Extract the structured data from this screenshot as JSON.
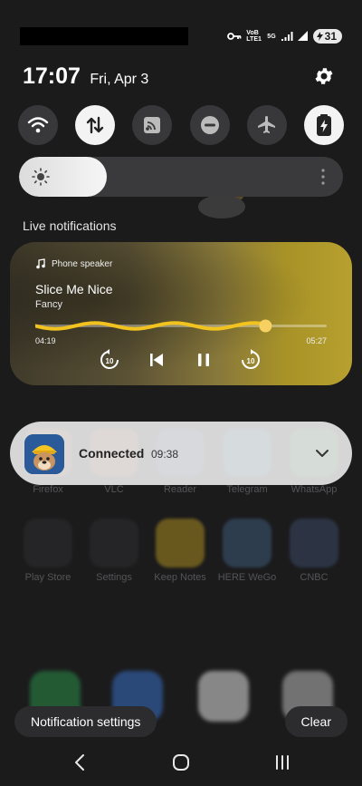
{
  "status": {
    "network_labels": [
      "VoB LTE1",
      "5G"
    ],
    "battery": "31"
  },
  "header": {
    "time": "17:07",
    "date": "Fri, Apr 3"
  },
  "quick_settings": [
    {
      "name": "wifi-icon",
      "active": false
    },
    {
      "name": "data-transfer-icon",
      "active": true
    },
    {
      "name": "cast-icon",
      "active": false
    },
    {
      "name": "do-not-disturb-icon",
      "active": false
    },
    {
      "name": "airplane-icon",
      "active": false
    },
    {
      "name": "battery-saver-icon",
      "active": true
    }
  ],
  "brightness": {
    "level": 0.27
  },
  "live_notifications": {
    "label": "Live notifications",
    "media": {
      "source": "Phone speaker",
      "title": "Slice Me Nice",
      "artist": "Fancy",
      "elapsed": "04:19",
      "total": "05:27",
      "progress": 0.79
    }
  },
  "notification": {
    "title": "Connected",
    "time": "09:38"
  },
  "background_apps": [
    "Firefox",
    "VLC",
    "Reader",
    "Telegram",
    "WhatsApp",
    "Play Store",
    "Settings",
    "Keep Notes",
    "HERE WeGo",
    "CNBC"
  ],
  "footer": {
    "settings_label": "Notification settings",
    "clear_label": "Clear"
  },
  "colors": {
    "accent_yellow": "#f2c21f",
    "panel_bg": "#1b1b1c"
  }
}
